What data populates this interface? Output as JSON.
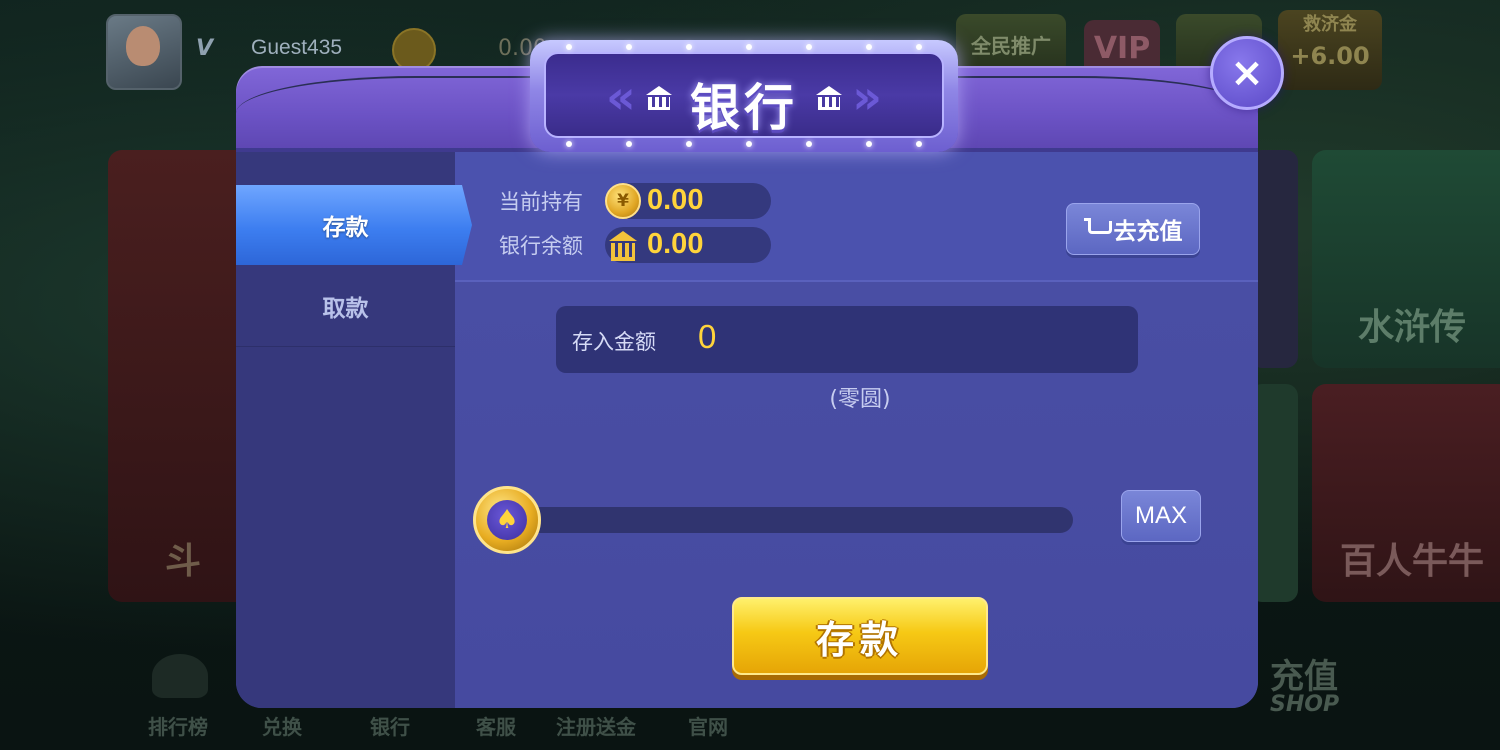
{
  "background": {
    "username": "Guest435",
    "vip_tag": "V",
    "coin_value": "0.00",
    "promo_label": "全民推广",
    "vip_label": "VIP",
    "relief_label": "救济金",
    "relief_value": "+6.00",
    "game_cards": [
      "斗",
      "水浒传",
      "百人牛牛"
    ],
    "bottom_nav": [
      "排行榜",
      "兑换",
      "银行",
      "客服",
      "注册送金",
      "官网"
    ],
    "shop": {
      "title": "充值",
      "sub": "SHOP"
    }
  },
  "dialog": {
    "title": "银行",
    "close_label": "×",
    "tabs": [
      {
        "label": "存款",
        "active": true
      },
      {
        "label": "取款",
        "active": false
      }
    ],
    "holdings": {
      "label": "当前持有",
      "value": "0.00",
      "icon": "coin-icon"
    },
    "bank_balance": {
      "label": "银行余额",
      "value": "0.00",
      "icon": "bank-icon"
    },
    "recharge_button": "去充值",
    "amount": {
      "label": "存入金额",
      "value": "0",
      "in_words": "(零圆)"
    },
    "slider": {
      "value": 0,
      "max_label": "MAX"
    },
    "deposit_button": "存款"
  },
  "colors": {
    "accent_gold": "#ffd43b",
    "tab_active": "#3d7ef0",
    "panel": "#45479a",
    "deposit_button": "#f6c915"
  }
}
